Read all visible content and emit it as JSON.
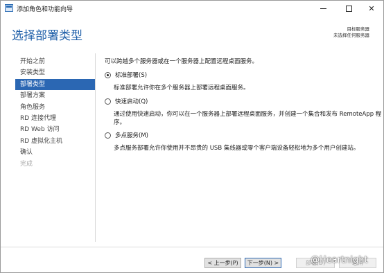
{
  "window": {
    "title": "添加角色和功能向导",
    "minimize_glyph": "—",
    "maximize_glyph": "☐",
    "close_glyph": "✕"
  },
  "header": {
    "page_title": "选择部署类型",
    "dest_label": "目标服务器",
    "dest_value": "未选择任何服务器"
  },
  "sidebar": {
    "items": [
      {
        "label": "开始之前",
        "state": "normal"
      },
      {
        "label": "安装类型",
        "state": "normal"
      },
      {
        "label": "部署类型",
        "state": "active"
      },
      {
        "label": "部署方案",
        "state": "normal"
      },
      {
        "label": "角色服务",
        "state": "normal"
      },
      {
        "label": "RD 连接代理",
        "state": "normal"
      },
      {
        "label": "RD Web 访问",
        "state": "normal"
      },
      {
        "label": "RD 虚拟化主机",
        "state": "normal"
      },
      {
        "label": "确认",
        "state": "normal"
      },
      {
        "label": "完成",
        "state": "disabled"
      }
    ]
  },
  "main": {
    "intro": "可以跨越多个服务器或在一个服务器上配置远程桌面服务。",
    "options": [
      {
        "label": "标准部署(S)",
        "checked": true,
        "description": "标准部署允许你在多个服务器上部署远程桌面服务。"
      },
      {
        "label": "快速启动(Q)",
        "checked": false,
        "description": "通过使用快速启动，你可以在一个服务器上部署远程桌面服务，并创建一个集合和发布 RemoteApp 程序。"
      },
      {
        "label": "多点服务(M)",
        "checked": false,
        "description": "多点服务部署允许你使用并不昂贵的 USB 集线器或零个客户端设备轻松地为多个用户创建站。"
      }
    ]
  },
  "footer": {
    "prev_label": "< 上一步(P)",
    "next_label": "下一步(N) >",
    "deploy_label": "部署(D)",
    "cancel_label": "取消"
  },
  "watermark": "@Heartnight",
  "colors": {
    "accent": "#2b67b3",
    "title_blue": "#1d5ea8"
  }
}
